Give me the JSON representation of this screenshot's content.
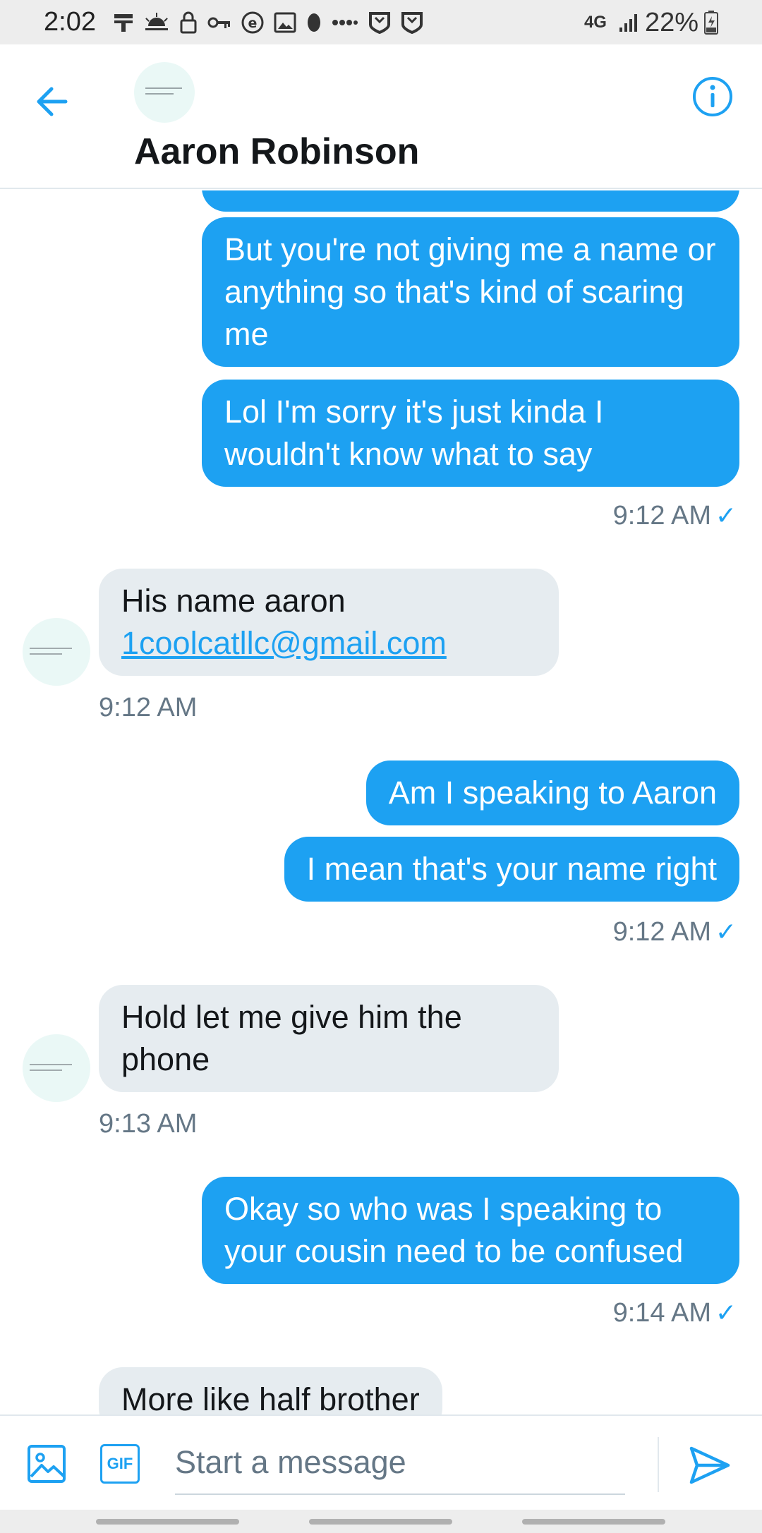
{
  "status_bar": {
    "time": "2:02",
    "network": "4G",
    "battery": "22%",
    "icons": [
      "tool-icon",
      "weather-icon",
      "lock-icon",
      "key-icon",
      "e-icon",
      "image-icon",
      "dot-icon",
      "more-icon",
      "shield-icon",
      "shield-icon"
    ]
  },
  "header": {
    "contact_name": "Aaron Robinson",
    "back_icon": "arrow-left-icon",
    "info_icon": "info-icon"
  },
  "messages": [
    {
      "direction": "out",
      "text": "But you're not giving me a name or anything so that's kind of scaring me"
    },
    {
      "direction": "out",
      "text": "Lol I'm sorry it's just kinda I wouldn't know what to say"
    },
    {
      "direction": "out",
      "timestamp": "9:12 AM"
    },
    {
      "direction": "in",
      "text": "His name aaron",
      "link": "1coolcatllc@gmail.com",
      "timestamp": "9:12 AM"
    },
    {
      "direction": "out",
      "text": "Am I speaking to Aaron"
    },
    {
      "direction": "out",
      "text": "I mean that's your name right"
    },
    {
      "direction": "out",
      "timestamp": "9:12 AM"
    },
    {
      "direction": "in",
      "text": "Hold let me give him the phone",
      "timestamp": "9:13 AM"
    },
    {
      "direction": "out",
      "text": "Okay so who was I speaking to your cousin need to be confused",
      "timestamp": "9:14 AM"
    },
    {
      "direction": "in",
      "text": "More like half brother"
    }
  ],
  "read_receipt": "✓",
  "composer": {
    "placeholder": "Start a message",
    "gif_label": "GIF",
    "media_icon": "image-icon",
    "send_icon": "send-icon"
  },
  "colors": {
    "accent": "#1da1f2",
    "incoming_bubble": "#e6ecf0",
    "timestamp": "#657786",
    "status_bar": "#ededed"
  }
}
